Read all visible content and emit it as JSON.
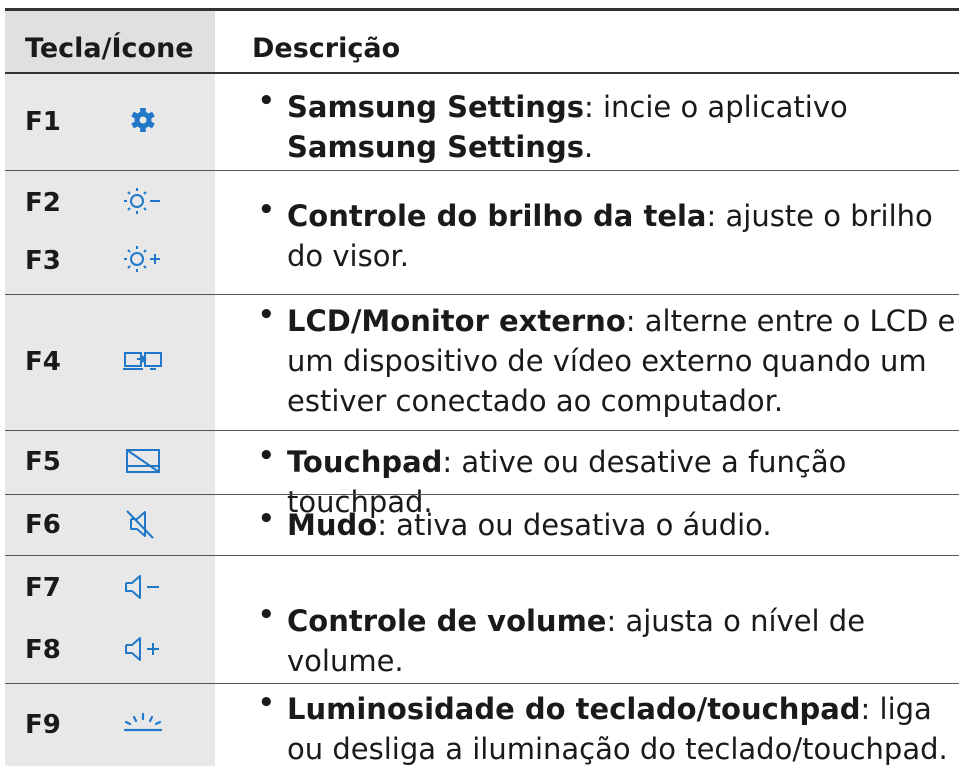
{
  "header": {
    "col_key": "Tecla/Ícone",
    "col_desc": "Descrição"
  },
  "bullet": "•",
  "rows": [
    {
      "keys": [
        "F1"
      ],
      "icons": [
        "gear-icon"
      ],
      "desc": [
        {
          "t": "Samsung Settings",
          "b": true
        },
        {
          "t": ": incie o aplicativo "
        },
        {
          "t": "Samsung Settings",
          "b": true
        },
        {
          "t": "."
        }
      ]
    },
    {
      "keys": [
        "F2",
        "F3"
      ],
      "icons": [
        "brightness-down-icon",
        "brightness-up-icon"
      ],
      "desc": [
        {
          "t": "Controle do brilho da tela",
          "b": true
        },
        {
          "t": ": ajuste o brilho do visor."
        }
      ]
    },
    {
      "keys": [
        "F4"
      ],
      "icons": [
        "display-switch-icon"
      ],
      "desc": [
        {
          "t": "LCD/Monitor externo",
          "b": true
        },
        {
          "t": ": alterne entre o LCD e um dispositivo de vídeo externo quando um estiver conectado ao computador."
        }
      ]
    },
    {
      "keys": [
        "F5"
      ],
      "icons": [
        "touchpad-off-icon"
      ],
      "desc": [
        {
          "t": "Touchpad",
          "b": true
        },
        {
          "t": ": ative ou desative a função touchpad."
        }
      ]
    },
    {
      "keys": [
        "F6"
      ],
      "icons": [
        "mute-icon"
      ],
      "desc": [
        {
          "t": "Mudo",
          "b": true
        },
        {
          "t": ": ativa ou desativa o áudio."
        }
      ]
    },
    {
      "keys": [
        "F7",
        "F8"
      ],
      "icons": [
        "volume-down-icon",
        "volume-up-icon"
      ],
      "desc": [
        {
          "t": "Controle de volume",
          "b": true
        },
        {
          "t": ": ajusta o nível de volume."
        }
      ]
    },
    {
      "keys": [
        "F9"
      ],
      "icons": [
        "keyboard-backlight-icon"
      ],
      "desc": [
        {
          "t": "Luminosidade do teclado/touchpad",
          "b": true
        },
        {
          "t": ": liga ou desliga a iluminação do teclado/touchpad."
        }
      ]
    }
  ],
  "colors": {
    "icon": "#1f78c8",
    "keycol_bg": "#e8e8e8",
    "rule": "#333333"
  }
}
